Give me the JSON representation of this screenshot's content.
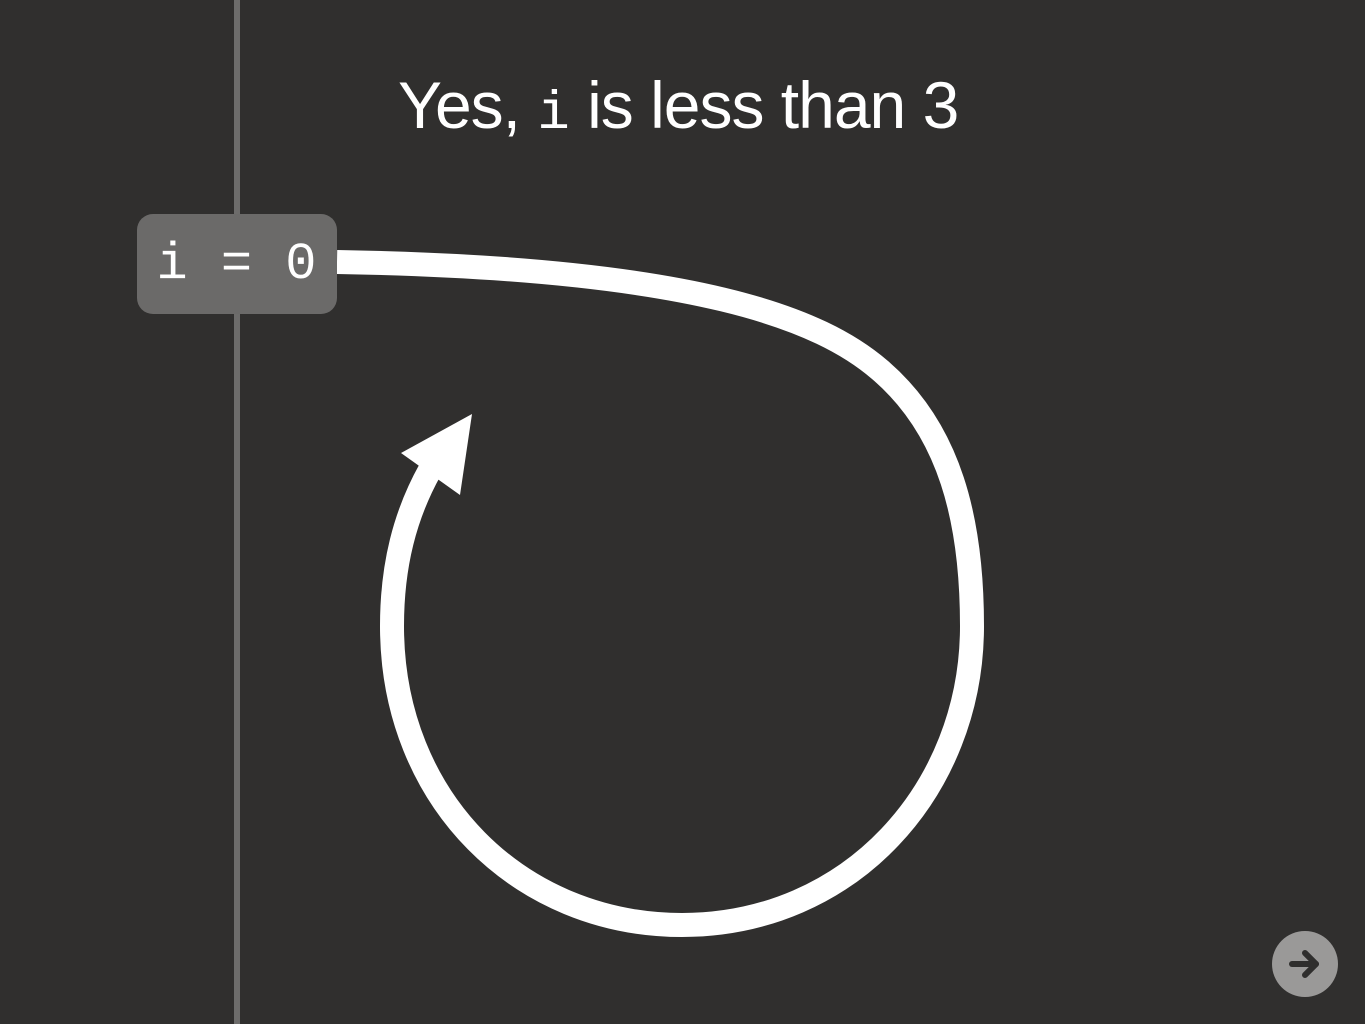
{
  "heading": {
    "prefix": "Yes, ",
    "code": "i",
    "suffix": " is less than 3"
  },
  "variable": {
    "label": "i = 0"
  },
  "controls": {
    "next_icon": "arrow-right-icon"
  },
  "colors": {
    "background": "#302f2e",
    "timeline": "#6d6c6b",
    "box": "#6b6a69",
    "arrow": "#ffffff",
    "button": "#9a9998"
  }
}
